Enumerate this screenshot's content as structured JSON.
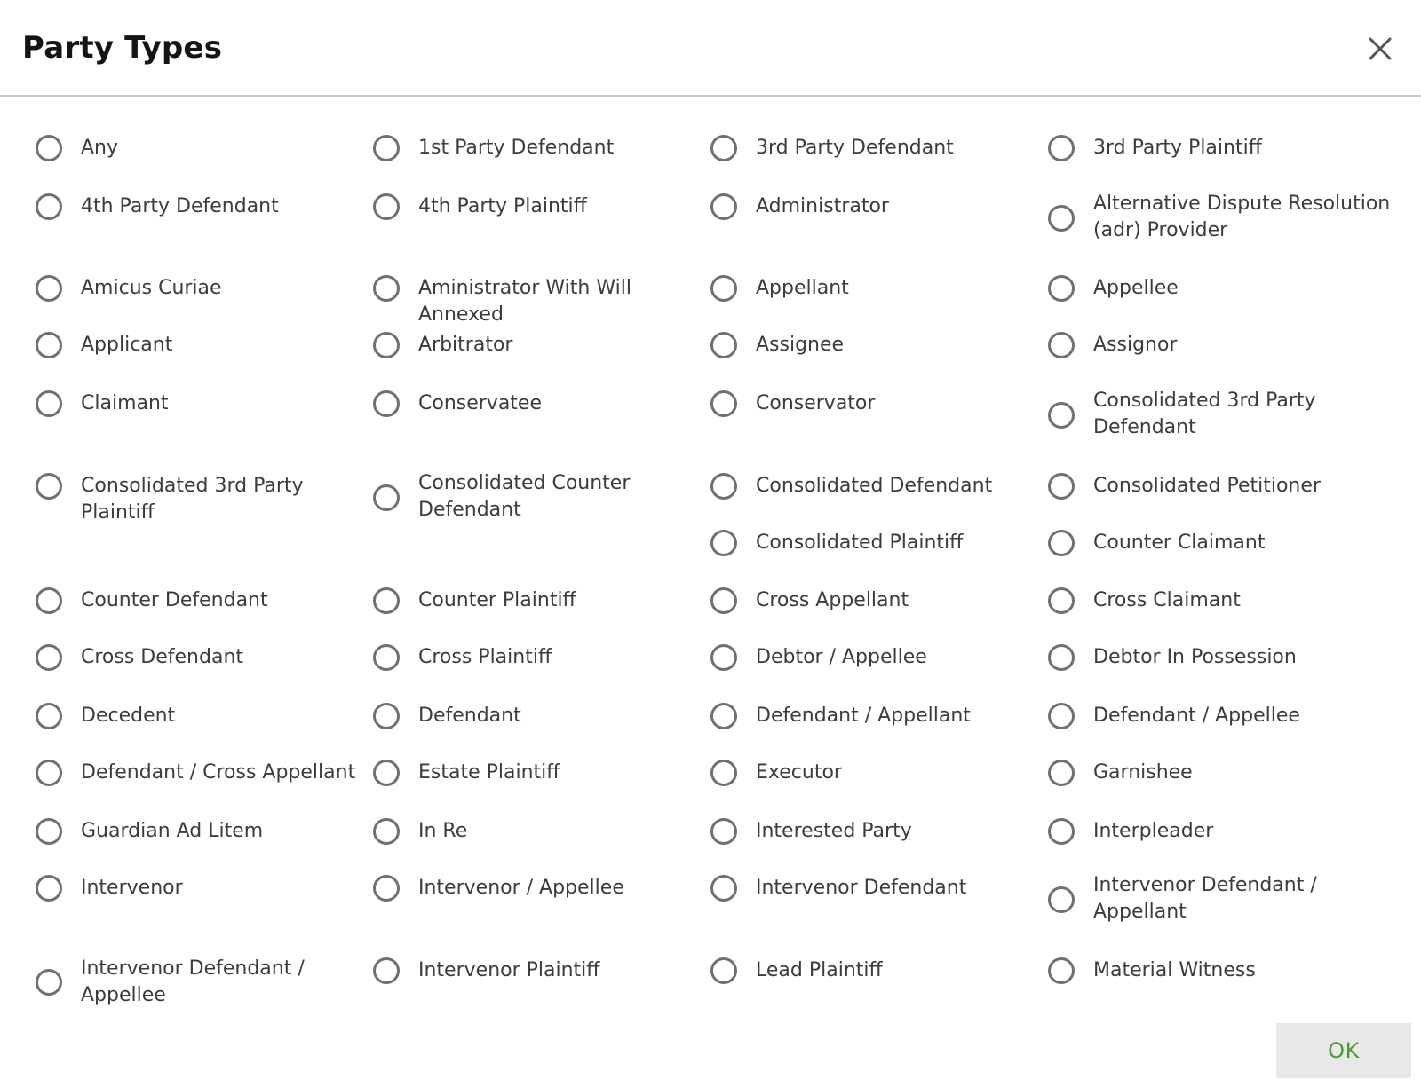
{
  "dialog": {
    "title": "Party Types",
    "close_icon": "close-icon",
    "ok_label": "OK"
  },
  "colors": {
    "title": "#141414",
    "label": "#3c3c3c",
    "radio_border": "#707070",
    "ok_text": "#4f9a3c",
    "ok_bg": "#e8e8e8",
    "divider": "#c8c8c8"
  },
  "party_types": [
    "Any",
    "1st Party Defendant",
    "3rd Party Defendant",
    "3rd Party Plaintiff",
    "4th Party Defendant",
    "4th Party Plaintiff",
    "Administrator",
    "Alternative Dispute Resolution (adr) Provider",
    "Amicus Curiae",
    "Aministrator With Will Annexed",
    "Appellant",
    "Appellee",
    "Applicant",
    "Arbitrator",
    "Assignee",
    "Assignor",
    "Claimant",
    "Conservatee",
    "Conservator",
    "Consolidated 3rd Party Defendant",
    "Consolidated 3rd Party Plaintiff",
    "Consolidated Counter Defendant",
    "Consolidated Defendant",
    "Consolidated Petitioner",
    "Consolidated Plaintiff",
    "Counter Claimant",
    "Counter Defendant",
    "Counter Plaintiff",
    "Cross Appellant",
    "Cross Claimant",
    "Cross Defendant",
    "Cross Plaintiff",
    "Debtor / Appellee",
    "Debtor In Possession",
    "Decedent",
    "Defendant",
    "Defendant / Appellant",
    "Defendant / Appellee",
    "Defendant / Cross Appellant",
    "Estate Plaintiff",
    "Executor",
    "Garnishee",
    "Guardian Ad Litem",
    "In Re",
    "Interested Party",
    "Interpleader",
    "Intervenor",
    "Intervenor / Appellee",
    "Intervenor Defendant",
    "Intervenor Defendant / Appellant",
    "Intervenor Defendant / Appellee",
    "Intervenor Plaintiff",
    "Lead Plaintiff",
    "Material Witness"
  ]
}
